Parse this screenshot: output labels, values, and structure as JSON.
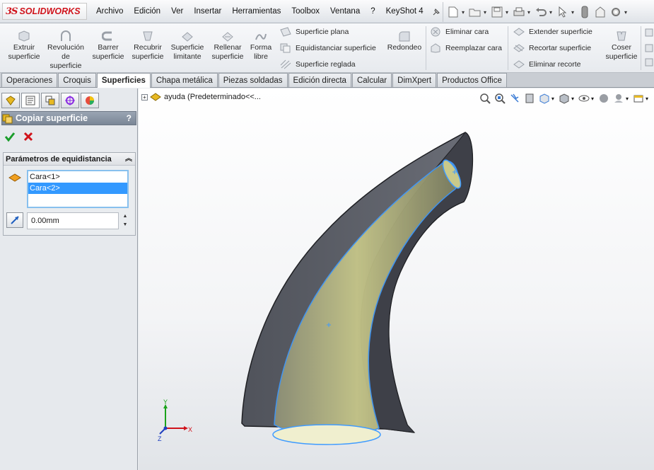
{
  "app": {
    "logo_ds": "3S",
    "logo_name": "SOLIDWORKS",
    "brand_color": "#d0131b"
  },
  "menu": [
    "Archivo",
    "Edición",
    "Ver",
    "Insertar",
    "Herramientas",
    "Toolbox",
    "Ventana",
    "?",
    "KeyShot 4"
  ],
  "ribbon": {
    "extruir": "Extruir superficie",
    "revolucion": "Revolución de superficie",
    "barrer": "Barrer superficie",
    "recubrir": "Recubrir superficie",
    "limitante": "Superficie limitante",
    "rellenar": "Rellenar superficie",
    "forma_libre": "Forma libre",
    "plana": "Superficie plana",
    "equidistanciar": "Equidistanciar superficie",
    "reglada": "Superficie reglada",
    "redondeo": "Redondeo",
    "eliminar_cara": "Eliminar cara",
    "reemplazar_cara": "Reemplazar cara",
    "extender": "Extender superficie",
    "recortar": "Recortar superficie",
    "eliminar_recorte": "Eliminar recorte",
    "coser": "Coser superficie"
  },
  "tabs": [
    "Operaciones",
    "Croquis",
    "Superficies",
    "Chapa metálica",
    "Piezas soldadas",
    "Edición directa",
    "Calcular",
    "DimXpert",
    "Productos Office"
  ],
  "active_tab": "Superficies",
  "panel": {
    "title": "Copiar superficie",
    "help": "?",
    "group_title": "Parámetros de equidistancia",
    "faces": [
      "Cara<1>",
      "Cara<2>"
    ],
    "selected_face": "Cara<2>",
    "distance": "0.00mm"
  },
  "tree": {
    "expander": "+",
    "label": "ayuda  (Predeterminado<<..."
  },
  "triad": {
    "x": "X",
    "y": "Y",
    "z": "Z"
  },
  "colors": {
    "selection_blue": "#3399ff",
    "offset_surface": "#c9c98a",
    "solid_gray": "#5d6069",
    "edge_highlight": "#3f9bff"
  }
}
